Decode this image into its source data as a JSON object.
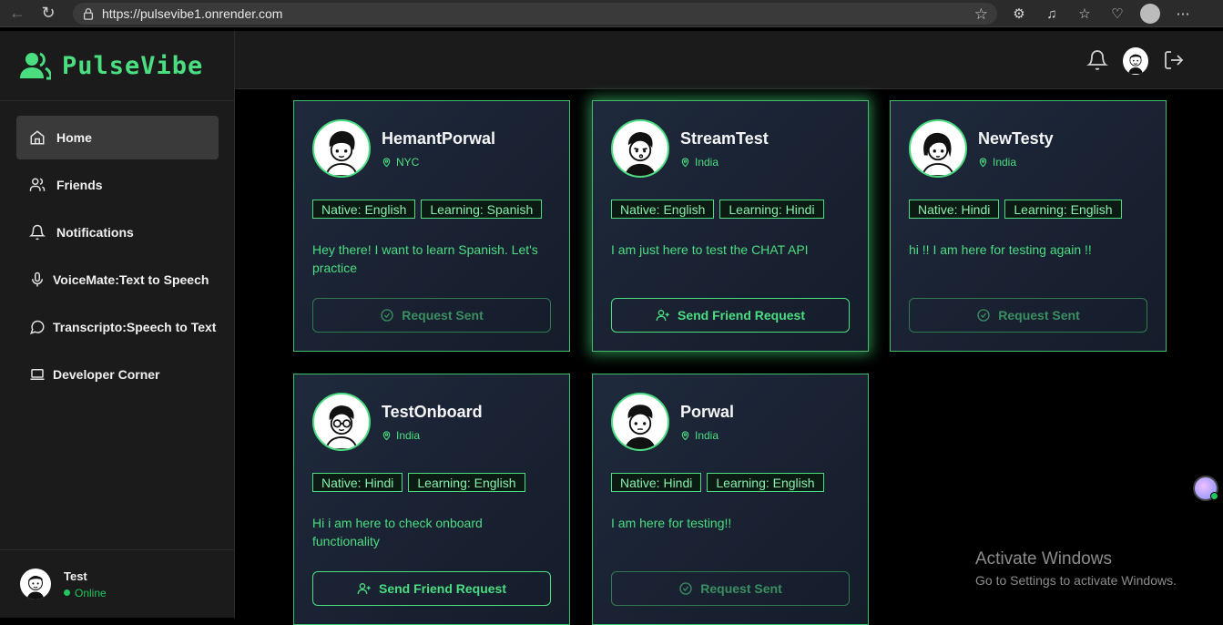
{
  "browser": {
    "url": "https://pulsevibe1.onrender.com"
  },
  "sidebar": {
    "brand": "PulseVibe",
    "items": [
      {
        "label": "Home",
        "icon": "home-icon",
        "active": true
      },
      {
        "label": "Friends",
        "icon": "users-icon"
      },
      {
        "label": "Notifications",
        "icon": "bell-icon"
      },
      {
        "label": "VoiceMate:Text to Speech",
        "icon": "mic-icon"
      },
      {
        "label": "Transcripto:Speech to Text",
        "icon": "message-circle-icon"
      },
      {
        "label": "Developer Corner",
        "icon": "laptop-icon"
      }
    ],
    "user": {
      "name": "Test",
      "status": "Online"
    }
  },
  "cards": [
    {
      "name": "HemantPorwal",
      "location": "NYC",
      "native": "Native: English",
      "learning": "Learning: Spanish",
      "bio": "Hey there! I want to learn Spanish. Let's practice",
      "action": "Request Sent"
    },
    {
      "name": "StreamTest",
      "location": "India",
      "native": "Native: English",
      "learning": "Learning: Hindi",
      "bio": "I am just here to test the CHAT API",
      "action": "Send Friend Request"
    },
    {
      "name": "NewTesty",
      "location": "India",
      "native": "Native: Hindi",
      "learning": "Learning: English",
      "bio": "hi !! I am here for testing again !!",
      "action": "Request Sent"
    },
    {
      "name": "TestOnboard",
      "location": "India",
      "native": "Native: Hindi",
      "learning": "Learning: English",
      "bio": "Hi i am here to check onboard functionality",
      "action": "Send Friend Request"
    },
    {
      "name": "Porwal",
      "location": "India",
      "native": "Native: Hindi",
      "learning": "Learning: English",
      "bio": "I am here for testing!!",
      "action": "Request Sent"
    }
  ],
  "watermark": {
    "title": "Activate Windows",
    "subtitle": "Go to Settings to activate Windows."
  },
  "colors": {
    "accent": "#4ade80",
    "background": "#000000",
    "sidebar": "#1b1b1b",
    "card": "#1a2233"
  }
}
